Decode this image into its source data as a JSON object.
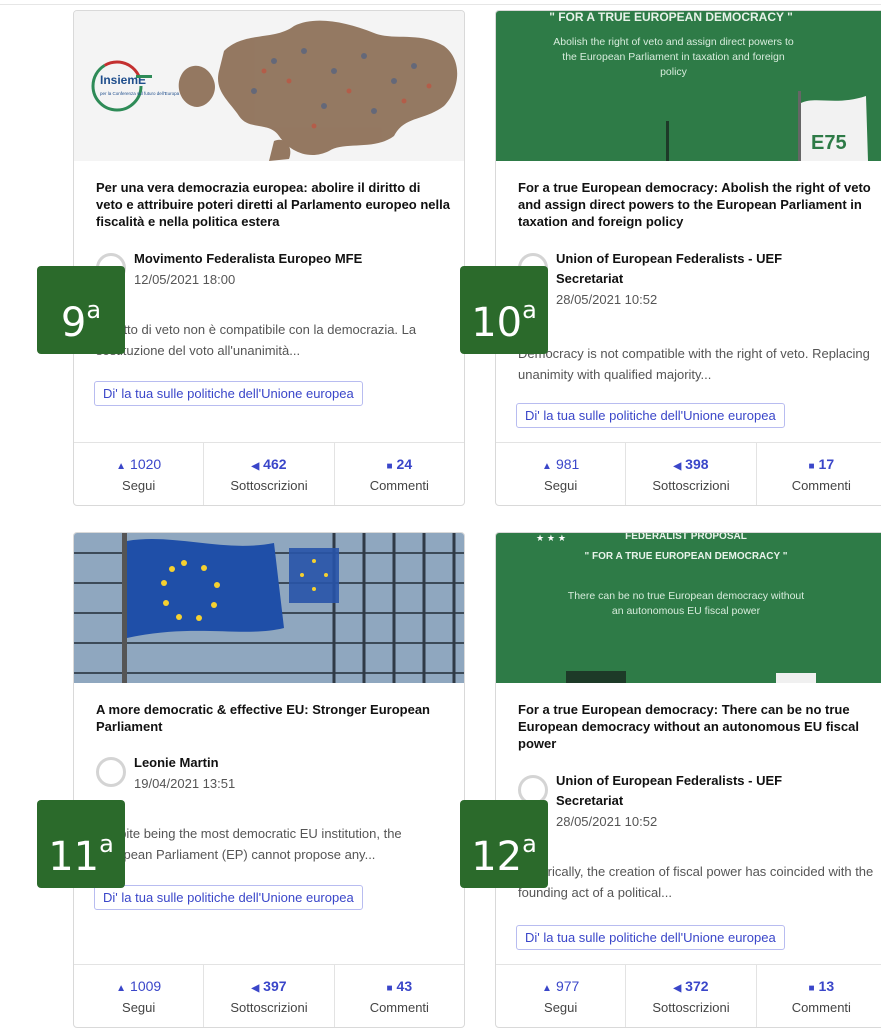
{
  "cards": [
    {
      "title": "Per una vera democrazia europea: abolire il diritto di veto e attribuire poteri diretti al Parlamento europeo nella fiscalità e nella politica estera",
      "author": "Movimento Federalista Europeo MFE",
      "date": "12/05/2021 18:00",
      "excerpt": "Il diritto di veto non è compatibile con la democrazia. La sostituzione del voto all'unanimità...",
      "tag": "Di' la tua sulle politiche dell'Unione europea",
      "stats": {
        "follow": "1020",
        "follow_label": "Segui",
        "subs": "462",
        "subs_label": "Sottoscrizioni",
        "comments": "24",
        "comments_label": "Commenti"
      },
      "image": {
        "logo_text": "InsiemE",
        "logo_sub": "per la Conferenza sul futuro dell'Europa"
      }
    },
    {
      "title": "For a true European democracy: Abolish the right of veto and assign direct powers to the European Parliament in taxation and foreign policy",
      "author": "Union of European Federalists - UEF Secretariat",
      "date": "28/05/2021 10:52",
      "excerpt": "Democracy is not compatible with the right of veto. Replacing unanimity with qualified majority...",
      "tag": "Di' la tua sulle politiche dell'Unione europea",
      "stats": {
        "follow": "981",
        "follow_label": "Segui",
        "subs": "398",
        "subs_label": "Sottoscrizioni",
        "comments": "17",
        "comments_label": "Commenti"
      },
      "image": {
        "headline": "\" FOR A TRUE EUROPEAN DEMOCRACY \"",
        "body": "Abolish the right of veto and assign direct powers to the European Parliament in taxation and foreign policy",
        "flag_text": "E75"
      }
    },
    {
      "title": "A more democratic & effective EU: Stronger European Parliament",
      "author": "Leonie Martin",
      "date": "19/04/2021 13:51",
      "excerpt": "Despite being the most democratic EU institution, the European Parliament (EP) cannot propose any...",
      "tag": "Di' la tua sulle politiche dell'Unione europea",
      "stats": {
        "follow": "1009",
        "follow_label": "Segui",
        "subs": "397",
        "subs_label": "Sottoscrizioni",
        "comments": "43",
        "comments_label": "Commenti"
      }
    },
    {
      "title": "For a true European democracy: There can be no true European democracy without an autonomous EU fiscal power",
      "author": "Union of European Federalists - UEF Secretariat",
      "date": "28/05/2021 10:52",
      "excerpt": "Historically, the creation of fiscal power has coincided with the founding act of a political...",
      "tag": "Di' la tua sulle politiche dell'Unione europea",
      "stats": {
        "follow": "977",
        "follow_label": "Segui",
        "subs": "372",
        "subs_label": "Sottoscrizioni",
        "comments": "13",
        "comments_label": "Commenti"
      },
      "image": {
        "kicker": "FEDERALIST PROPOSAL",
        "headline": "\" FOR A TRUE EUROPEAN DEMOCRACY \"",
        "body": "There can be no true European democracy without an autonomous EU fiscal power"
      }
    }
  ],
  "ranks": [
    {
      "num": "9",
      "suffix": "a"
    },
    {
      "num": "10",
      "suffix": "a"
    },
    {
      "num": "11",
      "suffix": "a"
    },
    {
      "num": "12",
      "suffix": "a"
    }
  ],
  "icons": {
    "follow": "bell-icon",
    "subs": "megaphone-icon",
    "comments": "comment-icon"
  },
  "colors": {
    "accent": "#3a46c9",
    "green_banner": "#2e7b47",
    "rank_badge": "#2b6a2b"
  }
}
